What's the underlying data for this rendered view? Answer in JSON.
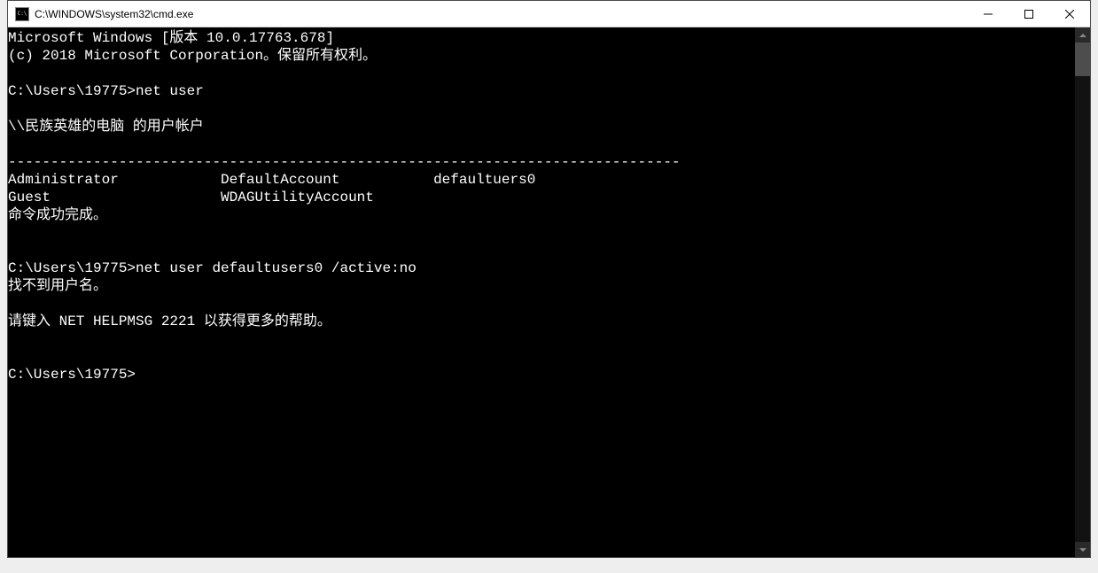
{
  "window": {
    "title": "C:\\WINDOWS\\system32\\cmd.exe"
  },
  "terminal": {
    "lines": [
      "Microsoft Windows [版本 10.0.17763.678]",
      "(c) 2018 Microsoft Corporation。保留所有权利。",
      "",
      "C:\\Users\\19775>net user",
      "",
      "\\\\民族英雄的电脑 的用户帐户",
      "",
      "-------------------------------------------------------------------------------",
      "Administrator            DefaultAccount           defaultuers0",
      "Guest                    WDAGUtilityAccount",
      "命令成功完成。",
      "",
      "",
      "C:\\Users\\19775>net user defaultusers0 /active:no",
      "找不到用户名。",
      "",
      "请键入 NET HELPMSG 2221 以获得更多的帮助。",
      "",
      ""
    ],
    "current_prompt": "C:\\Users\\19775>"
  }
}
